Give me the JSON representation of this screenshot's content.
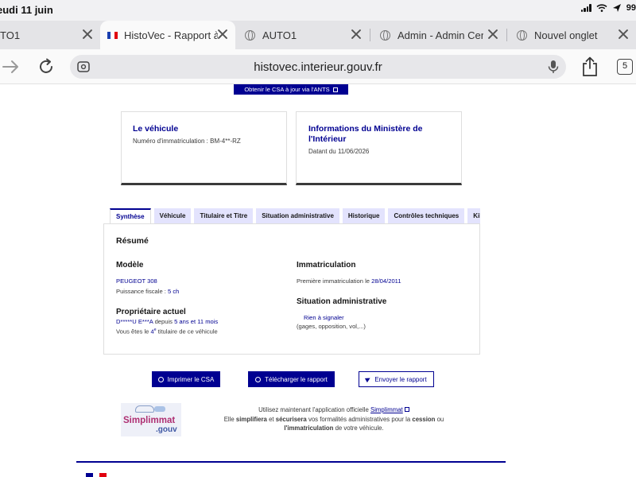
{
  "status_bar": {
    "time": "eudi 11 juin",
    "battery": "99"
  },
  "browser": {
    "tabs": [
      {
        "label": "TO1"
      },
      {
        "label": "HistoVec - Rapport à jour"
      },
      {
        "label": "AUTO1"
      },
      {
        "label": "Admin - Admin Center"
      },
      {
        "label": "Nouvel onglet"
      }
    ],
    "url": "histovec.interieur.gouv.fr",
    "tab_count": "5",
    "icons": [
      "forward-arrow-icon",
      "reload-icon",
      "page-settings-icon",
      "mic-icon",
      "share-icon",
      "tabs-overview-icon",
      "globe-icon",
      "close-icon"
    ]
  },
  "page": {
    "ants_button": "Obtenir le CSA à jour via l'ANTS",
    "vehicle_card": {
      "title": "Le véhicule",
      "plate_label": "Numéro d'immatriculation :",
      "plate": "BM-4**-RZ"
    },
    "ministry_card": {
      "title": "Informations du Ministère de l'Intérieur",
      "date_label": "Datant du",
      "date": "11/06/2026"
    },
    "tabs": [
      {
        "label": "Synthèse"
      },
      {
        "label": "Véhicule"
      },
      {
        "label": "Titulaire et Titre"
      },
      {
        "label": "Situation administrative"
      },
      {
        "label": "Historique"
      },
      {
        "label": "Contrôles techniques"
      },
      {
        "label": "Kil"
      }
    ],
    "summary": {
      "title": "Résumé",
      "model_heading": "Modèle",
      "model": "PEUGEOT 308",
      "fiscal_label": "Puissance fiscale :",
      "fiscal": "5 ch",
      "owner_heading": "Propriétaire actuel",
      "owner_name": "D*****U E***A",
      "owner_since_label": "depuis",
      "owner_since": "5 ans et 11 mois",
      "titulaire_pre": "Vous êtes le",
      "titulaire_num": "4",
      "titulaire_sup": "e",
      "titulaire_post": "titulaire de ce véhicule",
      "immat_heading": "Immatriculation",
      "first_immat_label": "Première immatriculation le",
      "first_immat": "28/04/2011",
      "situation_heading": "Situation administrative",
      "situation_value": "Rien à signaler",
      "situation_note": "(gages, opposition, vol,...)"
    },
    "actions": {
      "print": "Imprimer le CSA",
      "download": "Télécharger le rapport",
      "send": "Envoyer le rapport"
    },
    "simplimmat": {
      "logo_word": "Simplimmat",
      "logo_gouv": ".gouv",
      "line1_pre": "Utilisez maintenant l'application officielle",
      "link": "Simplimmat",
      "line2_a": "Elle",
      "line2_b": "simplifiera",
      "line2_c": "et",
      "line2_d": "sécurisera",
      "line2_e": "vos formalités administratives pour la",
      "line2_f": "cession",
      "line2_g": "ou",
      "line3_a": "l'immatriculation",
      "line3_b": "de votre véhicule."
    }
  },
  "colors": {
    "dsfr_blue": "#000091",
    "tab_bg": "#e3e3fd",
    "simplimmat_pink": "#ae2f72"
  }
}
